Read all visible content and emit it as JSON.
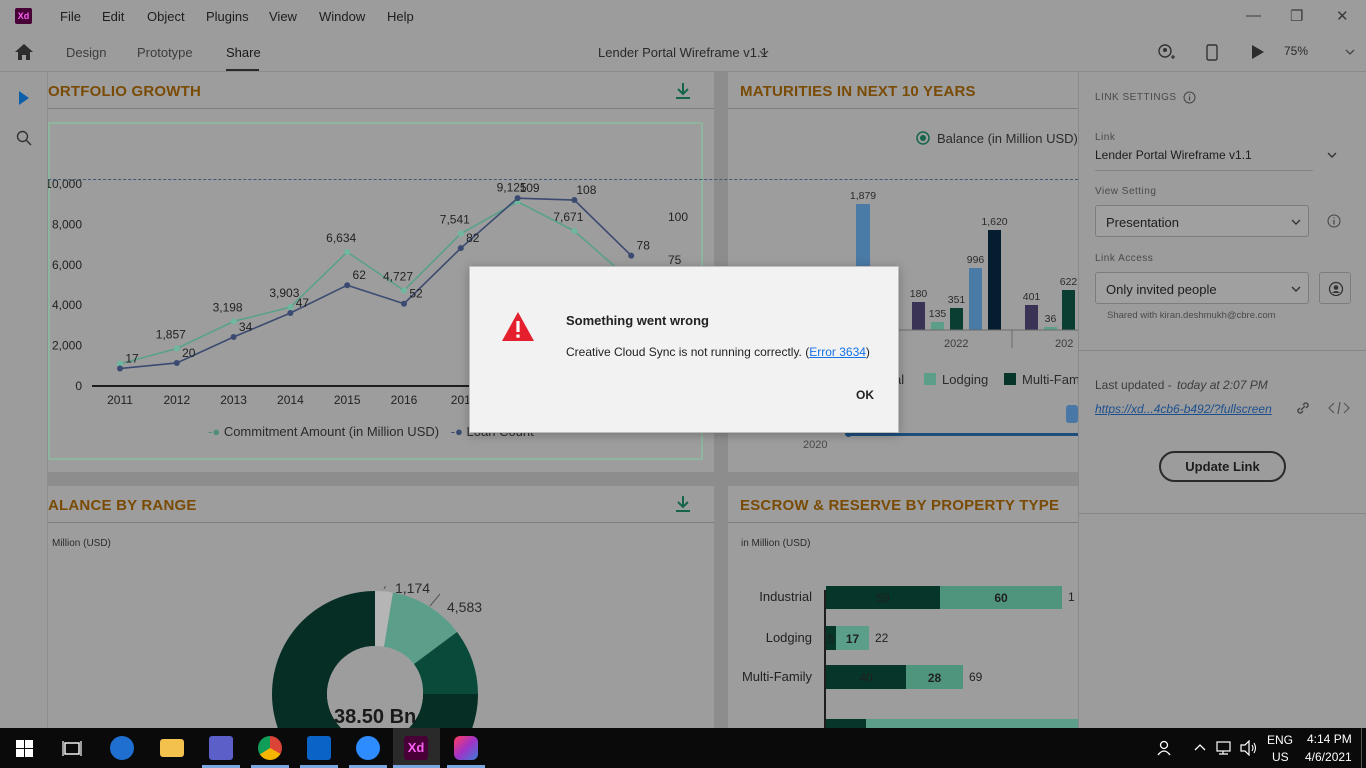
{
  "app": {
    "logo": "Xd",
    "menu": [
      "File",
      "Edit",
      "Object",
      "Plugins",
      "View",
      "Window",
      "Help"
    ],
    "window_controls": {
      "minimize": "—",
      "maximize": "❐",
      "close": "✕"
    }
  },
  "toolbar": {
    "tabs": [
      "Design",
      "Prototype",
      "Share"
    ],
    "active_tab": "Share",
    "doc_title": "Lender Portal Wireframe v1.1",
    "zoom": "75%"
  },
  "panels": {
    "portfolio": {
      "title": "ORTFOLIO GROWTH",
      "legend": [
        "Commitment Amount (in Million USD)",
        "Loan Count"
      ]
    },
    "maturities": {
      "title": "MATURITIES IN NEXT 10 YEARS",
      "legend_balance": "Balance (in Million USD)",
      "legend_bottom": [
        "al",
        "Lodging",
        "Multi-Fam"
      ],
      "slider_label": "2020"
    },
    "balance_range": {
      "title": "ALANCE BY RANGE",
      "subtitle": "Million (USD)",
      "labels": [
        "1,174",
        "4,583"
      ],
      "center": "38.50 Bn"
    },
    "escrow": {
      "title": "ESCROW & RESERVE BY PROPERTY TYPE",
      "subtitle": "in Million (USD)"
    }
  },
  "chart_data": [
    {
      "type": "line",
      "title": "ORTFOLIO GROWTH",
      "x": [
        "2011",
        "2012",
        "2013",
        "2014",
        "2015",
        "2016",
        "201",
        "",
        "",
        ""
      ],
      "y_ticks": [
        "0",
        "2,000",
        "4,000",
        "6,000",
        "8,000",
        "10,000"
      ],
      "y2_ticks": [
        "75",
        "100"
      ],
      "series": [
        {
          "name": "Commitment Amount (in Million USD)",
          "values": [
            1100,
            1857,
            3198,
            3903,
            6634,
            4727,
            7541,
            9125,
            7671,
            null
          ],
          "labels": [
            "",
            "1,857",
            "3,198",
            "3,903",
            "6,634",
            "4,727",
            "7,541",
            "9,125",
            "7,671",
            ""
          ]
        },
        {
          "name": "Loan Count",
          "values": [
            17,
            20,
            34,
            47,
            62,
            52,
            82,
            109,
            108,
            78
          ],
          "labels": [
            "17",
            "20",
            "34",
            "47",
            "62",
            "52",
            "82",
            "109",
            "108",
            "78"
          ]
        }
      ]
    },
    {
      "type": "bar",
      "title": "MATURITIES IN NEXT 10 YEARS",
      "x_labels": [
        "2022",
        "202"
      ],
      "bar_labels": [
        "1,879",
        "180",
        "135",
        "351",
        "996",
        "1,620",
        "401",
        "36",
        "622"
      ]
    },
    {
      "type": "pie",
      "title": "ALANCE BY RANGE",
      "labels": [
        "1,174",
        "4,583"
      ],
      "center_label": "38.50 Bn"
    },
    {
      "type": "bar",
      "title": "ESCROW & RESERVE BY PROPERTY TYPE",
      "categories": [
        "Industrial",
        "Lodging",
        "Multi-Family"
      ],
      "segments": [
        [
          "59",
          "60"
        ],
        [
          "5",
          "17"
        ],
        [
          "40",
          "28"
        ]
      ],
      "totals": [
        "1",
        "22",
        "69"
      ]
    }
  ],
  "right_panel": {
    "header": "LINK SETTINGS",
    "link_label": "Link",
    "link_value": "Lender Portal Wireframe v1.1",
    "view_label": "View Setting",
    "view_value": "Presentation",
    "access_label": "Link Access",
    "access_value": "Only invited people",
    "shared_with": "Shared with kiran.deshmukh@cbre.com",
    "last_updated_label": "Last updated - ",
    "last_updated_value": "today at 2:07 PM",
    "url": "https://xd...4cb6-b492/?fullscreen",
    "update_button": "Update Link"
  },
  "dialog": {
    "title": "Something went wrong",
    "message": "Creative Cloud Sync is not running correctly. (",
    "link": "Error 3634",
    "message_end": ")",
    "ok": "OK"
  },
  "taskbar": {
    "lang1": "ENG",
    "lang2": "US",
    "time": "4:14 PM",
    "date": "4/6/2021"
  }
}
